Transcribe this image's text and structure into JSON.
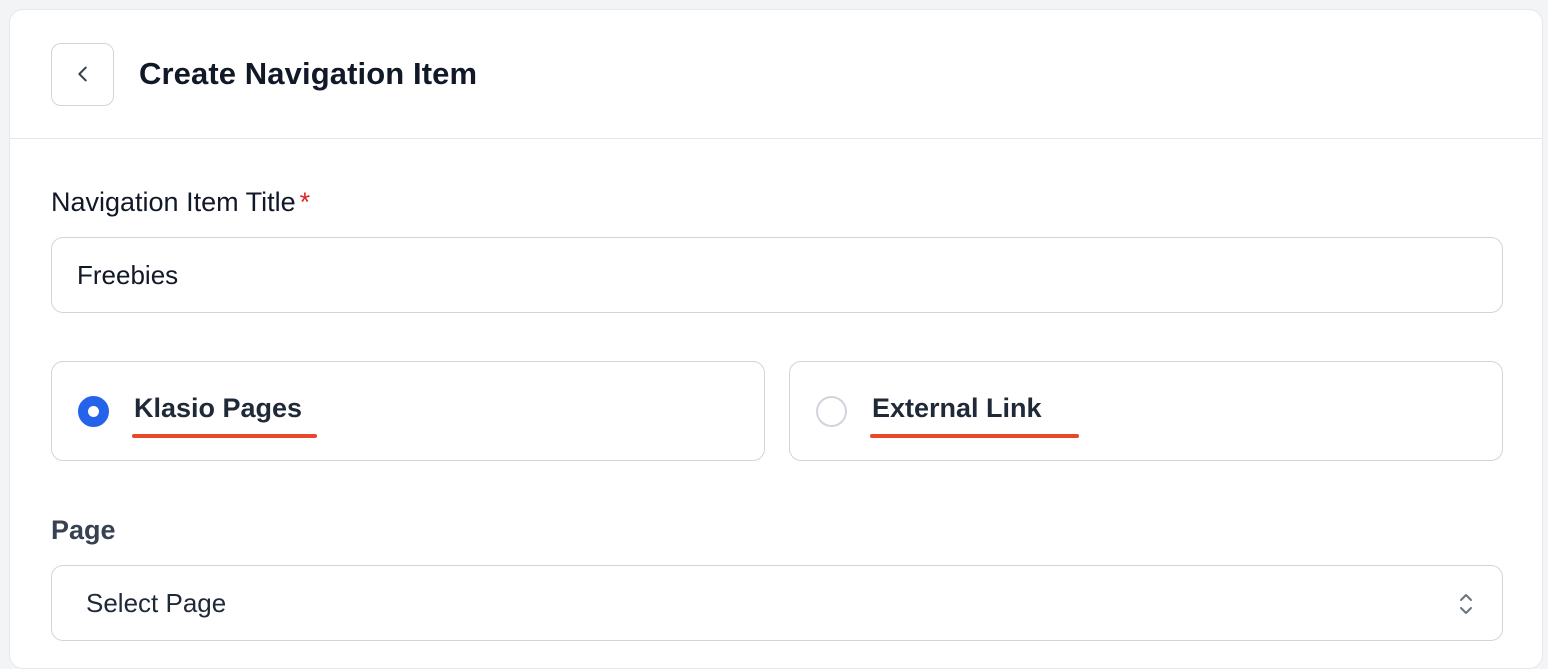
{
  "header": {
    "title": "Create Navigation Item",
    "back_icon": "chevron-left-icon"
  },
  "form": {
    "title_field": {
      "label": "Navigation Item Title",
      "required_marker": "*",
      "value": "Freebies"
    },
    "link_type": {
      "options": [
        {
          "label": "Klasio Pages",
          "checked": true
        },
        {
          "label": "External Link",
          "checked": false
        }
      ]
    },
    "page_field": {
      "label": "Page",
      "selected": "Select Page",
      "icon": "chevron-up-down-icon"
    }
  },
  "colors": {
    "accent": "#2563eb",
    "required": "#dc2626",
    "annotation_underline": "#e8472a",
    "border": "#d1d5db"
  }
}
